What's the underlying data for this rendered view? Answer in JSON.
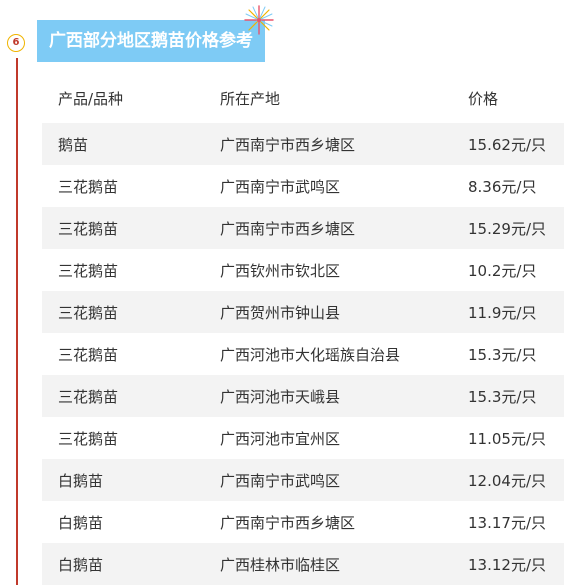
{
  "section": {
    "number": "6",
    "title": "广西部分地区鹅苗价格参考"
  },
  "colors": {
    "title_bg": "#7ecbf5",
    "timeline": "#c0392b",
    "badge_border": "#f0b400",
    "stripe": "#f3f3f3"
  },
  "table": {
    "headers": {
      "product": "产品/品种",
      "location": "所在产地",
      "price": "价格"
    },
    "rows": [
      {
        "product": "鹅苗",
        "location": "广西南宁市西乡塘区",
        "price": "15.62元/只"
      },
      {
        "product": "三花鹅苗",
        "location": "广西南宁市武鸣区",
        "price": "8.36元/只"
      },
      {
        "product": "三花鹅苗",
        "location": "广西南宁市西乡塘区",
        "price": "15.29元/只"
      },
      {
        "product": "三花鹅苗",
        "location": "广西钦州市钦北区",
        "price": "10.2元/只"
      },
      {
        "product": "三花鹅苗",
        "location": "广西贺州市钟山县",
        "price": "11.9元/只"
      },
      {
        "product": "三花鹅苗",
        "location": "广西河池市大化瑶族自治县",
        "price": "15.3元/只"
      },
      {
        "product": "三花鹅苗",
        "location": "广西河池市天峨县",
        "price": "15.3元/只"
      },
      {
        "product": "三花鹅苗",
        "location": "广西河池市宜州区",
        "price": "11.05元/只"
      },
      {
        "product": "白鹅苗",
        "location": "广西南宁市武鸣区",
        "price": "12.04元/只"
      },
      {
        "product": "白鹅苗",
        "location": "广西南宁市西乡塘区",
        "price": "13.17元/只"
      },
      {
        "product": "白鹅苗",
        "location": "广西桂林市临桂区",
        "price": "13.12元/只"
      }
    ]
  }
}
